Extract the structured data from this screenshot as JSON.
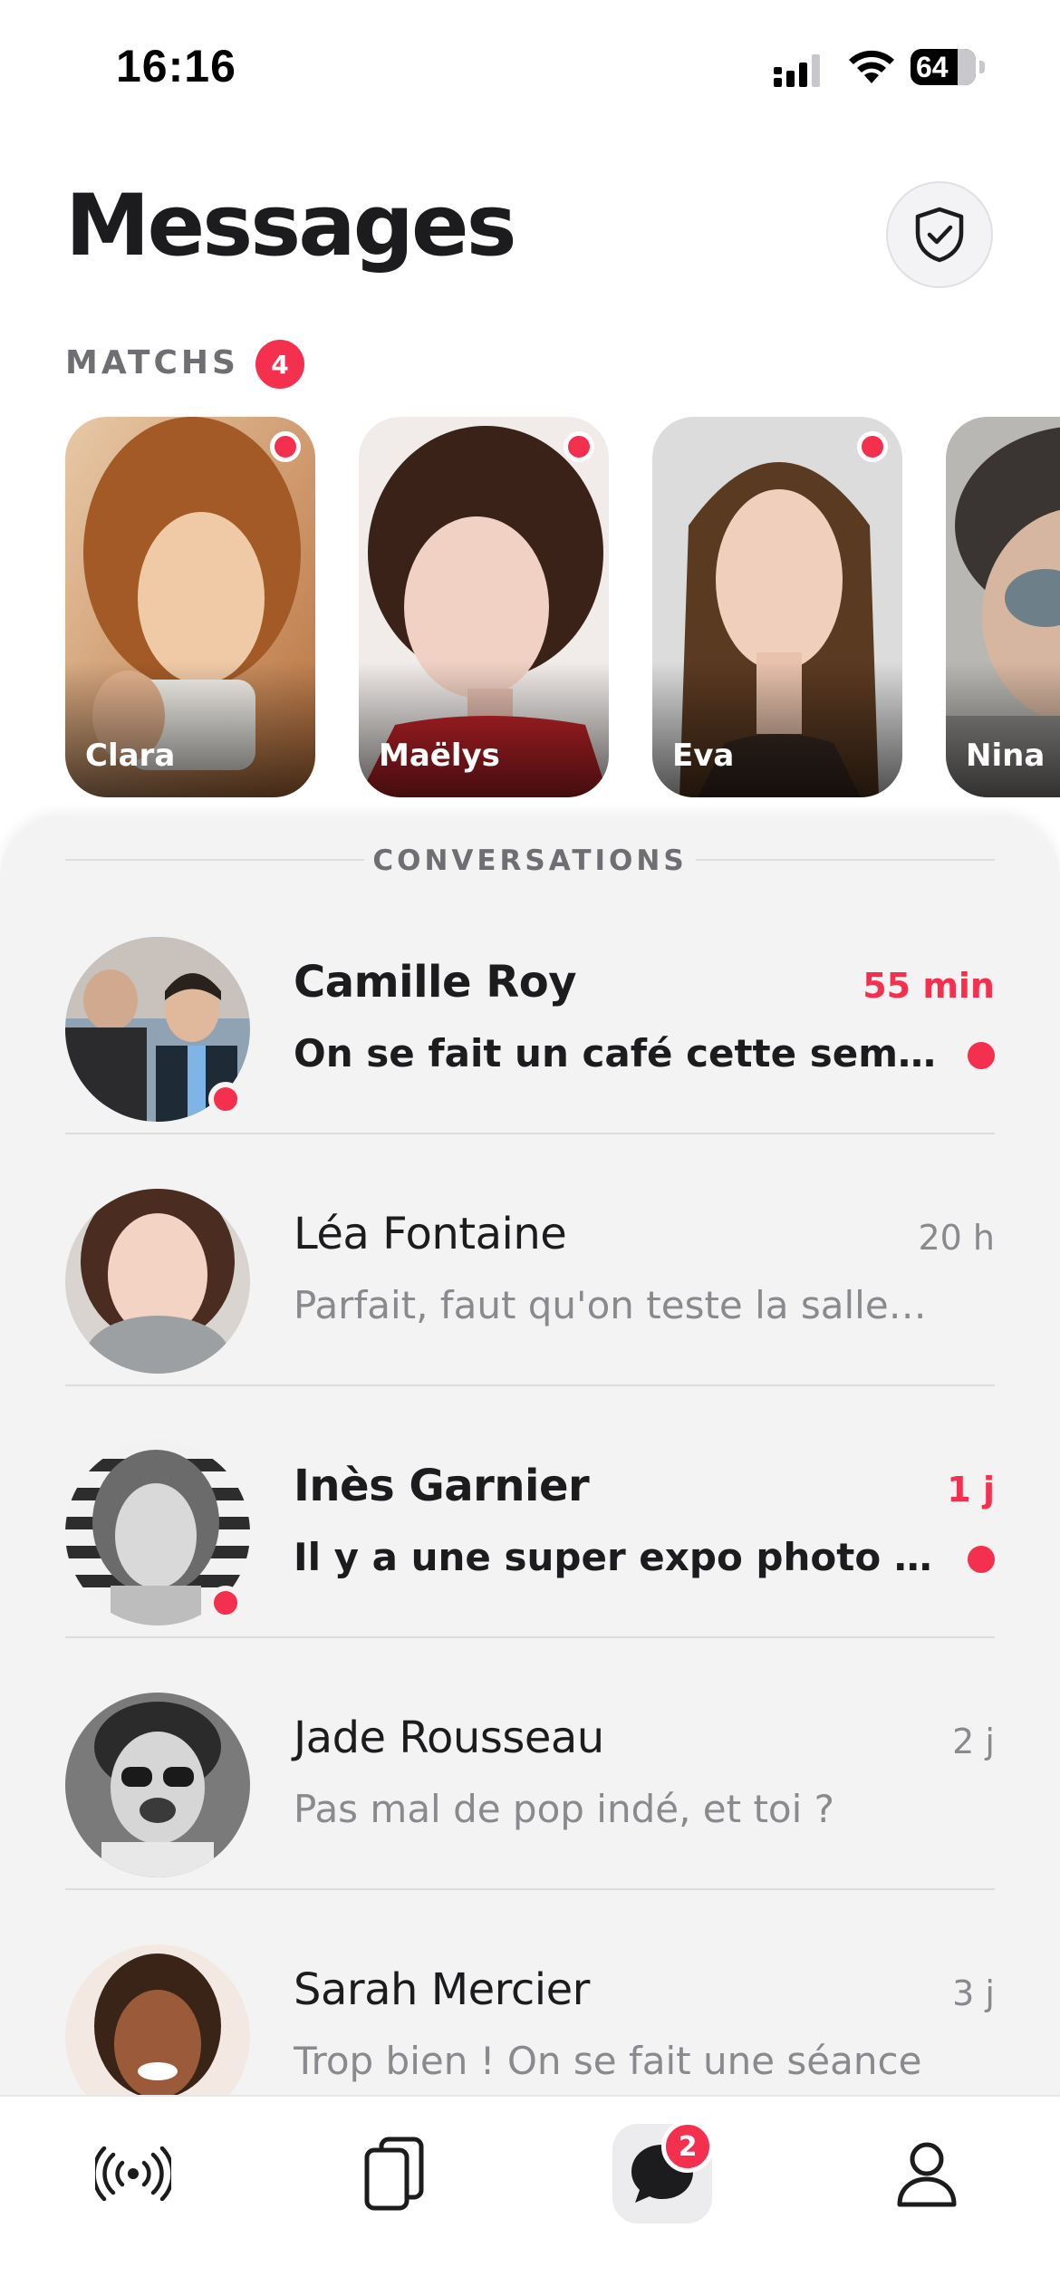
{
  "status_bar": {
    "time": "16:16",
    "battery": "64"
  },
  "header": {
    "title": "Messages",
    "shield_icon": "shield-check-icon"
  },
  "matches": {
    "label": "MATCHS",
    "count": "4",
    "items": [
      {
        "name": "Clara",
        "new": true
      },
      {
        "name": "Maëlys",
        "new": true
      },
      {
        "name": "Eva",
        "new": true
      },
      {
        "name": "Nina",
        "new": false
      }
    ]
  },
  "conversations": {
    "label": "CONVERSATIONS",
    "items": [
      {
        "name": "Camille Roy",
        "time": "55 min",
        "preview": "On se fait un café cette semaine ?",
        "unread": true,
        "online": true
      },
      {
        "name": "Léa Fontaine",
        "time": "20 h",
        "preview": "Parfait, faut qu'on teste la salle en ville",
        "unread": false,
        "online": false
      },
      {
        "name": "Inès Garnier",
        "time": "1 j",
        "preview": "Il y a une super expo photo au musée",
        "unread": true,
        "online": true
      },
      {
        "name": "Jade Rousseau",
        "time": "2 j",
        "preview": "Pas mal de pop indé, et toi ?",
        "unread": false,
        "online": false
      },
      {
        "name": "Sarah Mercier",
        "time": "3 j",
        "preview": "Trop bien ! On se fait une séance",
        "unread": false,
        "online": false
      }
    ]
  },
  "tab_bar": {
    "items": [
      {
        "icon": "live-broadcast-icon"
      },
      {
        "icon": "cards-stack-icon"
      },
      {
        "icon": "chat-bubble-icon",
        "badge": "2",
        "active": true
      },
      {
        "icon": "profile-icon"
      }
    ]
  },
  "colors": {
    "accent": "#f5304f",
    "text": "#1c1c1e",
    "muted": "#8a8a8e",
    "panel": "#f3f3f4"
  }
}
